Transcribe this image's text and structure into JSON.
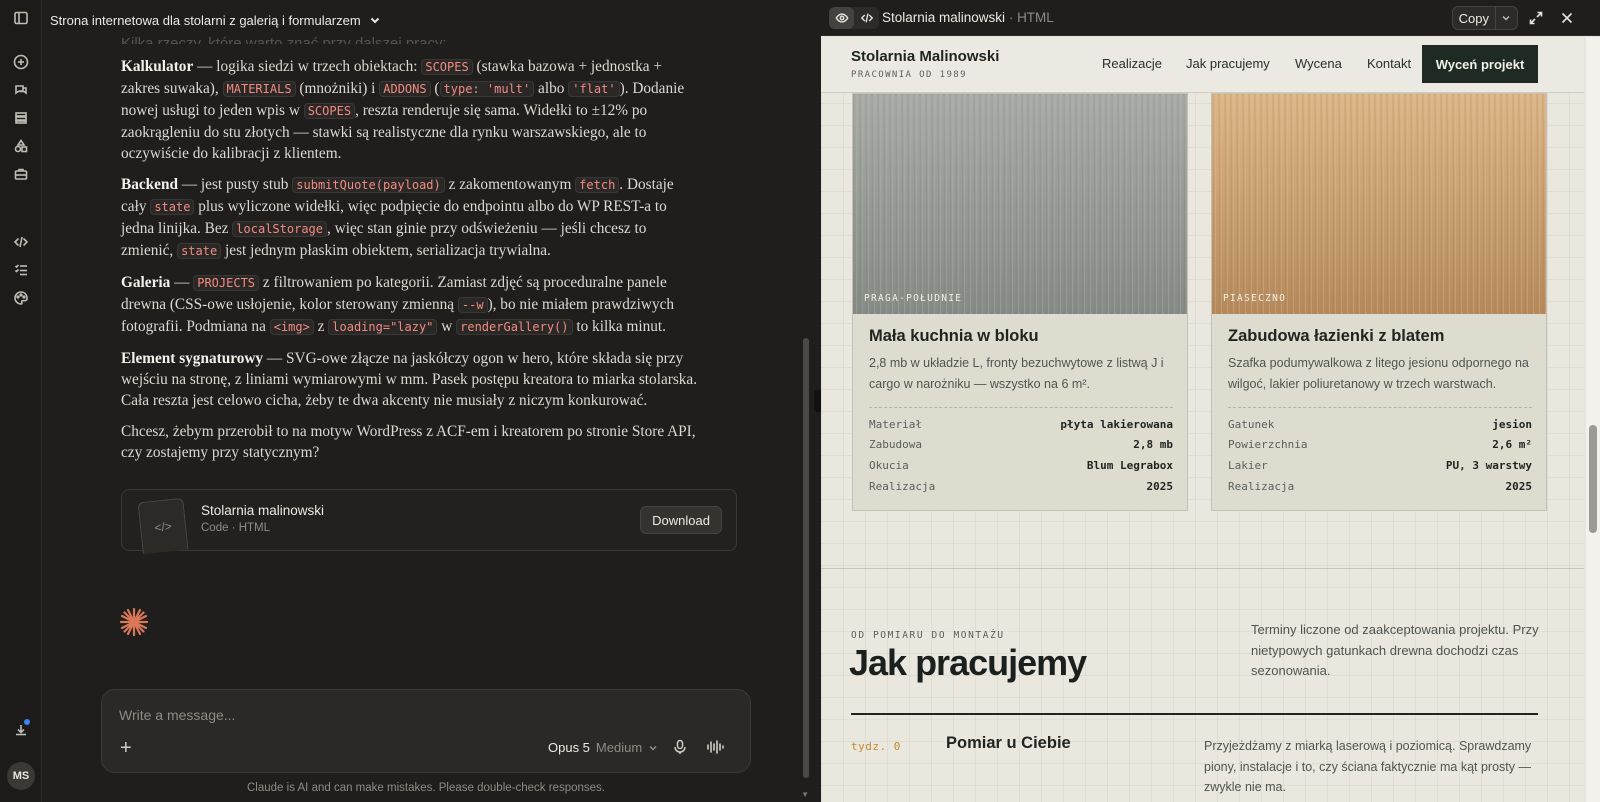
{
  "chat": {
    "title": "Strona internetowa dla stolarni z galerią i formularzem",
    "faded_line": "Kilka rzeczy, które warto znać przy dalszej pracy:",
    "p1": {
      "lead": "Kalkulator",
      "t1": " — logika siedzi w trzech obiektach: ",
      "c1": "SCOPES",
      "t2": " (stawka bazowa + jednostka + zakres suwaka), ",
      "c2": "MATERIALS",
      "t3": " (mnożniki) i ",
      "c3": "ADDONS",
      "t4": " (",
      "c4": "type: 'mult'",
      "t5": " albo ",
      "c5": "'flat'",
      "t6": "). Dodanie nowej usługi to jeden wpis w ",
      "c6": "SCOPES",
      "t7": ", reszta renderuje się sama. Widełki to ±12% po zaokrągleniu do stu złotych — stawki są realistyczne dla rynku warszawskiego, ale to oczywiście do kalibracji z klientem."
    },
    "p2": {
      "lead": "Backend",
      "t1": " — jest pusty stub ",
      "c1": "submitQuote(payload)",
      "t2": " z zakomentowanym ",
      "c2": "fetch",
      "t3": ". Dostaje cały ",
      "c3": "state",
      "t4": " plus wyliczone widełki, więc podpięcie do endpointu albo do WP REST-a to jedna linijka. Bez ",
      "c4": "localStorage",
      "t5": ", więc stan ginie przy odświeżeniu — jeśli chcesz to zmienić, ",
      "c5": "state",
      "t6": " jest jednym płaskim obiektem, serializacja trywialna."
    },
    "p3": {
      "lead": "Galeria",
      "t1": " — ",
      "c1": "PROJECTS",
      "t2": " z filtrowaniem po kategorii. Zamiast zdjęć są proceduralne panele drewna (CSS-owe usłojenie, kolor sterowany zmienną ",
      "c2": "--w",
      "t3": "), bo nie miałem prawdziwych fotografii. Podmiana na ",
      "c3": "<img>",
      "t4": " z ",
      "c4": "loading=\"lazy\"",
      "t5": " w ",
      "c5": "renderGallery()",
      "t6": " to kilka minut."
    },
    "p4": {
      "lead": "Element sygnaturowy",
      "t1": " — SVG-owe złącze na jaskółczy ogon w hero, które składa się przy wejściu na stronę, z liniami wymiarowymi w mm. Pasek postępu kreatora to miarka stolarska. Cała reszta jest celowo cicha, żeby te dwa akcenty nie musiały z niczym konkurować."
    },
    "p5": "Chcesz, żebym przerobił to na motyw WordPress z ACF-em i kreatorem po stronie Store API, czy zostajemy przy statycznym?",
    "artifact": {
      "title": "Stolarnia malinowski",
      "subtitle": "Code · HTML",
      "download_label": "Download"
    },
    "composer": {
      "placeholder": "Write a message...",
      "model": "Opus 5",
      "effort": "Medium"
    },
    "disclaimer": "Claude is AI and can make mistakes. Please double-check responses.",
    "avatar_initials": "MS"
  },
  "panel": {
    "title": "Stolarnia malinowski",
    "type": "HTML",
    "copy_label": "Copy"
  },
  "site": {
    "brand": "Stolarnia Malinowski",
    "brand_sub": "PRACOWNIA OD 1989",
    "nav": [
      "Realizacje",
      "Jak pracujemy",
      "Wycena",
      "Kontakt"
    ],
    "cta": "Wyceń projekt",
    "projects": [
      {
        "location": "PRAGA-POŁUDNIE",
        "title": "Mała kuchnia w bloku",
        "desc": "2,8 mb w układzie L, fronty bezuchwytowe z listwą J i cargo w narożniku — wszystko na 6 m².",
        "specs": [
          [
            "Materiał",
            "płyta lakierowana"
          ],
          [
            "Zabudowa",
            "2,8 mb"
          ],
          [
            "Okucia",
            "Blum Legrabox"
          ],
          [
            "Realizacja",
            "2025"
          ]
        ],
        "wood_color": "#9a9d98"
      },
      {
        "location": "PIASECZNO",
        "title": "Zabudowa łazienki z blatem",
        "desc": "Szafka podumywalkowa z litego jesionu odpornego na wilgoć, lakier poliuretanowy w trzech warstwach.",
        "specs": [
          [
            "Gatunek",
            "jesion"
          ],
          [
            "Powierzchnia",
            "2,6 m²"
          ],
          [
            "Lakier",
            "PU, 3 warstwy"
          ],
          [
            "Realizacja",
            "2025"
          ]
        ],
        "wood_color": "#d0a877"
      }
    ],
    "process": {
      "kicker": "OD POMIARU DO MONTAŻU",
      "title": "Jak pracujemy",
      "note": "Terminy liczone od zaakceptowania projektu. Przy nietypowych gatunkach drewna dochodzi czas sezonowania.",
      "step": {
        "week": "tydz. 0",
        "title": "Pomiar u Ciebie",
        "desc": "Przyjeżdżamy z miarką laserową i poziomicą. Sprawdzamy piony, instalacje i to, czy ściana faktycznie ma kąt prosty — zwykle nie ma."
      }
    }
  },
  "colors": {
    "accent_code": "#f28b82",
    "cta_bg": "#1f2a25",
    "week_accent": "#c48a2f"
  }
}
